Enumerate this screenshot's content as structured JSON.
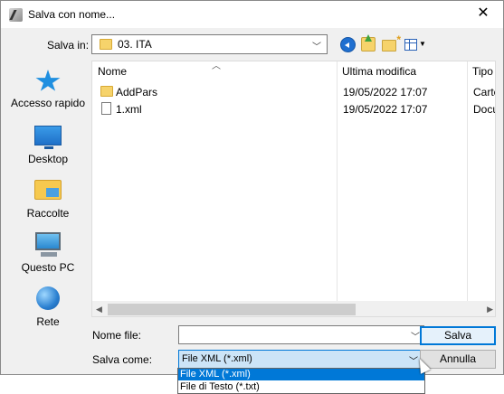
{
  "window": {
    "title": "Salva con nome...",
    "close_glyph": "✕"
  },
  "toolbar": {
    "save_in_label": "Salva in:",
    "save_in_value": "03. ITA"
  },
  "places": [
    {
      "label": "Accesso rapido",
      "icon": "star-icon"
    },
    {
      "label": "Desktop",
      "icon": "desktop-icon"
    },
    {
      "label": "Raccolte",
      "icon": "libraries-icon"
    },
    {
      "label": "Questo PC",
      "icon": "computer-icon"
    },
    {
      "label": "Rete",
      "icon": "network-icon"
    }
  ],
  "filelist": {
    "columns": [
      "Nome",
      "Ultima modifica",
      "Tipo"
    ],
    "rows": [
      {
        "name": "AddPars",
        "modified": "19/05/2022 17:07",
        "type": "Carte",
        "kind": "folder"
      },
      {
        "name": "1.xml",
        "modified": "19/05/2022 17:07",
        "type": "Docu",
        "kind": "file"
      }
    ]
  },
  "form": {
    "filename_label": "Nome file:",
    "filename_value": "",
    "filetype_label": "Salva come:",
    "filetype_value": "File XML (*.xml)",
    "filetype_options": [
      "File XML (*.xml)",
      "File di Testo (*.txt)"
    ],
    "save_button": "Salva",
    "cancel_button": "Annulla"
  },
  "colors": {
    "accent": "#0078d7",
    "selected_option_bg": "#0078d7",
    "combo_highlight": "#cce4f7"
  }
}
